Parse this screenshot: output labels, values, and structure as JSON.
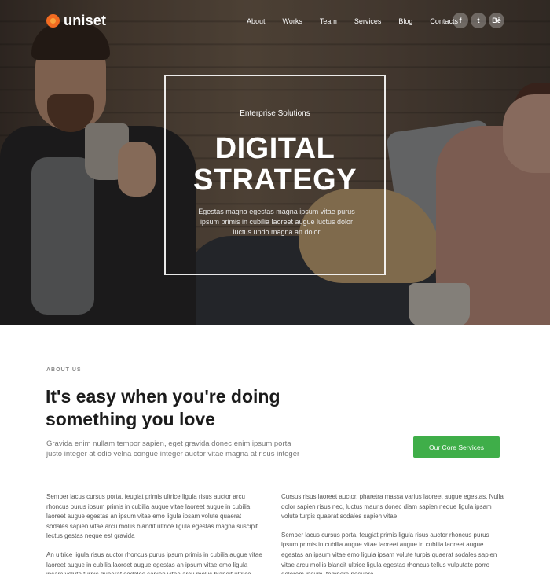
{
  "nav": {
    "logo_text": "uniset",
    "items": [
      "About",
      "Works",
      "Team",
      "Services",
      "Blog",
      "Contacts"
    ],
    "social": [
      {
        "icon": "facebook-icon",
        "glyph": "f"
      },
      {
        "icon": "twitter-icon",
        "glyph": "t"
      },
      {
        "icon": "behance-icon",
        "glyph": "Bē"
      }
    ]
  },
  "hero": {
    "eyebrow": "Enterprise Solutions",
    "headline_line1": "DIGITAL",
    "headline_line2": "STRATEGY",
    "text": "Egestas magna egestas magna ipsum vitae purus ipsum primis in cubilia laoreet augue luctus dolor luctus undo magna an dolor"
  },
  "about": {
    "label": "ABOUT US",
    "title": "It's easy when you're doing something you love",
    "lead": "Gravida enim nullam tempor sapien, eget gravida donec enim ipsum porta justo integer at odio velna congue integer auctor vitae magna at risus integer",
    "cta_label": "Our Core Services",
    "col_left": [
      "Semper lacus cursus porta, feugiat primis ultrice ligula risus auctor arcu rhoncus purus ipsum primis in cubilia augue vitae laoreet augue in cubilia laoreet augue egestas an ipsum vitae emo ligula ipsam volute quaerat sodales sapien vitae arcu mollis blandit ultrice ligula egestas magna suscipit lectus gestas neque est gravida",
      "An ultrice ligula risus auctor rhoncus purus ipsum primis in cubilia augue vitae laoreet augue in cubilia laoreet augue egestas an ipsum vitae emo ligula ipsam volute turpis quaerat sodales sapien vitae arcu mollis blandit ultrice"
    ],
    "col_right": [
      "Cursus risus laoreet auctor, pharetra massa varius laoreet augue egestas. Nulla dolor sapien risus nec, luctus mauris donec diam sapien neque ligula ipsam volute turpis quaerat sodales sapien vitae",
      "Semper lacus cursus porta, feugiat primis ligula risus auctor rhoncus purus ipsum primis in cubilia augue vitae laoreet augue in cubilia laoreet augue egestas an ipsum vitae emo ligula ipsam volute turpis quaerat sodales sapien vitae arcu mollis blandit ultrice ligula egestas rhoncus tellus vulputate porro dolorem ipsum, tempora posuere"
    ]
  },
  "colors": {
    "accent_green": "#3fae49",
    "logo_orange": "#f26b21"
  }
}
